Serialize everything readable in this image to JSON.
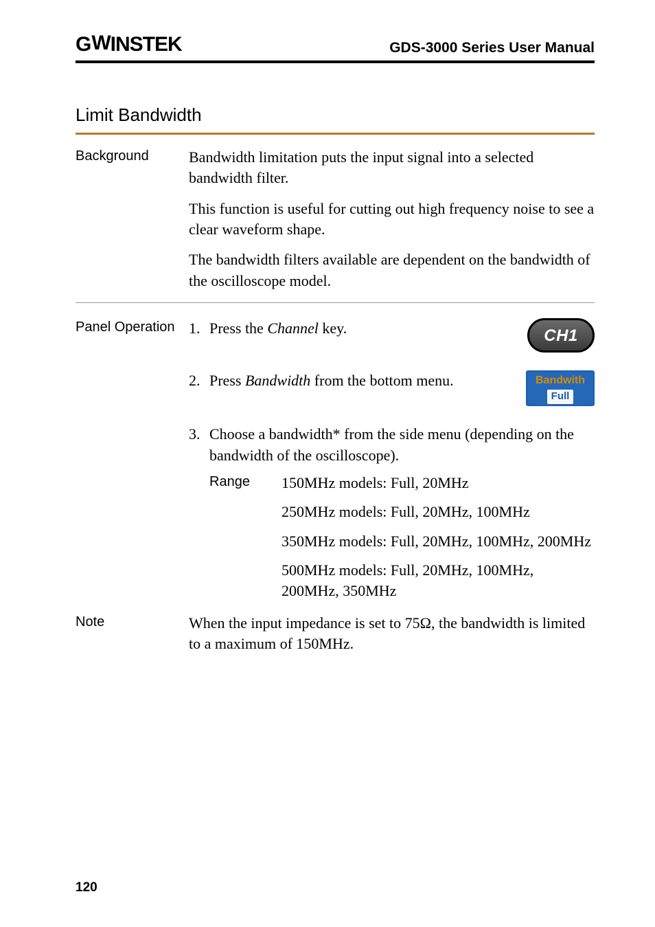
{
  "header": {
    "brand_prefix": "G",
    "brand_u": "W",
    "brand_rest": "INSTEK",
    "manual": "GDS-3000 Series User Manual"
  },
  "section": {
    "title": "Limit Bandwidth"
  },
  "background": {
    "label": "Background",
    "p1": "Bandwidth limitation puts the input signal into a selected bandwidth filter.",
    "p2": "This function is useful for cutting out high frequency noise to see a clear waveform shape.",
    "p3": "The bandwidth filters available are dependent on the bandwidth of the oscilloscope model."
  },
  "panel": {
    "label": "Panel Operation",
    "steps": {
      "s1_num": "1.",
      "s1_a": "Press the ",
      "s1_i": "Channel",
      "s1_b": " key.",
      "s1_btn": "CH1",
      "s2_num": "2.",
      "s2_a": "Press ",
      "s2_i": "Bandwidth",
      "s2_b": " from the bottom menu.",
      "s2_key_label": "Bandwith",
      "s2_key_val": "Full",
      "s3_num": "3.",
      "s3_text": "Choose a bandwidth* from the side menu (depending on the bandwidth of the oscilloscope)."
    },
    "range": {
      "label": "Range",
      "r1": "150MHz models: Full, 20MHz",
      "r2": "250MHz models: Full, 20MHz, 100MHz",
      "r3": "350MHz models: Full, 20MHz, 100MHz, 200MHz",
      "r4": "500MHz models: Full, 20MHz, 100MHz, 200MHz, 350MHz"
    }
  },
  "note": {
    "label": "Note",
    "text": "When the input impedance is set to 75Ω, the bandwidth is limited to a maximum of 150MHz."
  },
  "page": "120"
}
